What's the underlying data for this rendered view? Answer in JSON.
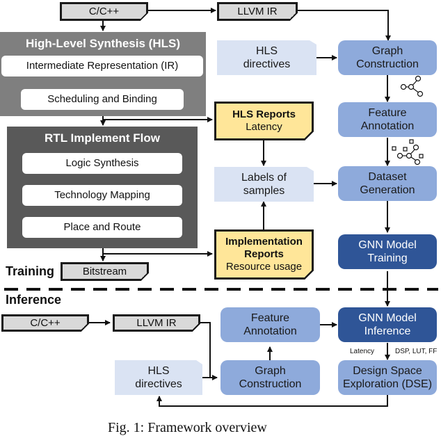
{
  "training": {
    "section_label": "Training",
    "cpp_file": "C/C++",
    "llvm_ir_file": "LLVM IR",
    "hls_panel": {
      "title": "High-Level Synthesis (HLS)",
      "steps": [
        "Intermediate Representation (IR)",
        "Scheduling and Binding"
      ]
    },
    "rtl_panel": {
      "title": "RTL Implement Flow",
      "steps": [
        "Logic Synthesis",
        "Technology Mapping",
        "Place and Route"
      ]
    },
    "bitstream_file": "Bitstream",
    "hls_reports": {
      "title": "HLS Reports",
      "subtitle": "Latency"
    },
    "impl_reports": {
      "title_line1": "Implementation",
      "title_line2": "Reports",
      "subtitle": "Resource usage"
    },
    "hls_directives": {
      "line1": "HLS",
      "line2": "directives"
    },
    "labels_of_samples": {
      "line1": "Labels of",
      "line2": "samples"
    },
    "graph_construction": {
      "line1": "Graph",
      "line2": "Construction"
    },
    "feature_annotation": {
      "line1": "Feature",
      "line2": "Annotation"
    },
    "dataset_generation": {
      "line1": "Dataset",
      "line2": "Generation"
    },
    "gnn_training": {
      "line1": "GNN Model",
      "line2": "Training"
    }
  },
  "inference": {
    "section_label": "Inference",
    "cpp_file": "C/C++",
    "llvm_ir_file": "LLVM IR",
    "hls_directives": {
      "line1": "HLS",
      "line2": "directives"
    },
    "feature_annotation": {
      "line1": "Feature",
      "line2": "Annotation"
    },
    "graph_construction": {
      "line1": "Graph",
      "line2": "Construction"
    },
    "gnn_inference": {
      "line1": "GNN Model",
      "line2": "Inference"
    },
    "latency_label": "Latency",
    "resource_label": "DSP, LUT, FF",
    "dse": {
      "line1": "Design Space",
      "line2": "Exploration (DSE)"
    }
  },
  "caption": "Fig. 1: Framework overview",
  "colors": {
    "file_fill": "#d9d9d9",
    "report_fill": "#ffe699",
    "hls_panel": "#7f7f7f",
    "rtl_panel": "#595959",
    "process_blue": "#8eaadb",
    "gnn_dark_blue": "#2f5597",
    "input_pale_blue": "#dae3f3"
  }
}
